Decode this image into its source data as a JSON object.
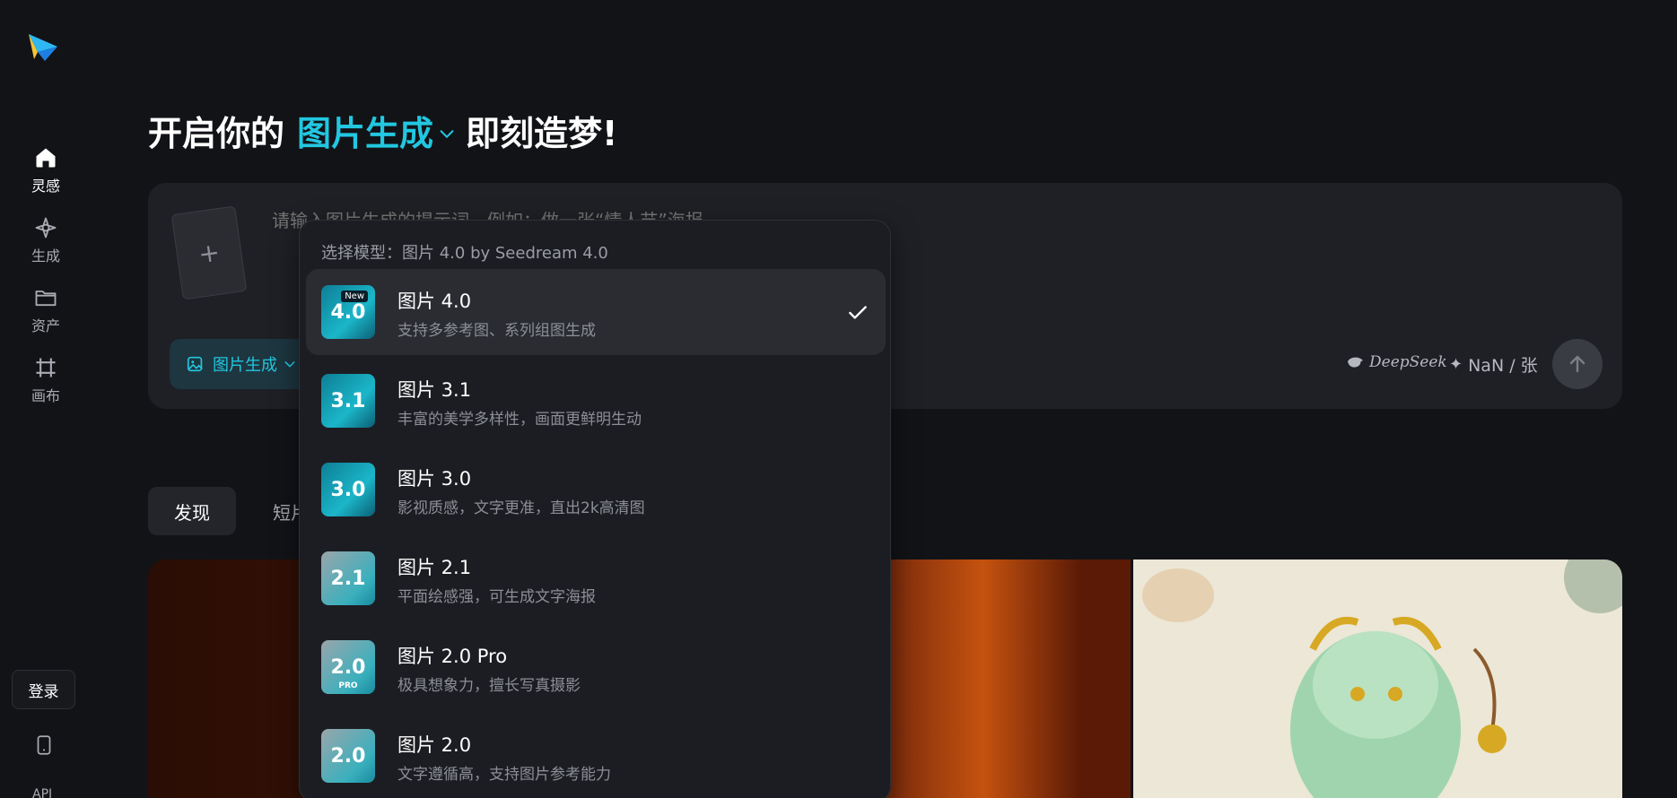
{
  "sidebar": {
    "items": [
      {
        "label": "灵感",
        "icon": "home-icon"
      },
      {
        "label": "生成",
        "icon": "sparkle-icon"
      },
      {
        "label": "资产",
        "icon": "folder-icon"
      },
      {
        "label": "画布",
        "icon": "canvas-icon"
      }
    ],
    "login_label": "登录",
    "api_label": "API"
  },
  "hero": {
    "prefix": "开启你的",
    "mode": "图片生成",
    "suffix": "即刻造梦!"
  },
  "prompt": {
    "placeholder": "请输入图片生成的提示词，例如：做一张“情人节”海报",
    "upload_icon": "+",
    "mode_label": "图片生成",
    "deepseek_label": "DeepSeek",
    "price_label": "NaN / 张"
  },
  "tabs": [
    "发现",
    "短片"
  ],
  "dropdown": {
    "header": "选择模型：图片 4.0 by Seedream 4.0",
    "models": [
      {
        "name": "图片 4.0",
        "desc": "支持多参考图、系列组图生成",
        "thumb": "4.0",
        "badge": "New",
        "selected": true
      },
      {
        "name": "图片 3.1",
        "desc": "丰富的美学多样性，画面更鲜明生动",
        "thumb": "3.1"
      },
      {
        "name": "图片 3.0",
        "desc": "影视质感，文字更准，直出2k高清图",
        "thumb": "3.0"
      },
      {
        "name": "图片 2.1",
        "desc": "平面绘感强，可生成文字海报",
        "thumb": "2.1"
      },
      {
        "name": "图片 2.0 Pro",
        "desc": "极具想象力，擅长写真摄影",
        "thumb": "2.0",
        "pro": "PRO"
      },
      {
        "name": "图片 2.0",
        "desc": "文字遵循高，支持图片参考能力",
        "thumb": "2.0"
      }
    ]
  },
  "colors": {
    "accent": "#22c7e0",
    "background": "#121317",
    "panel": "#1f2025"
  }
}
